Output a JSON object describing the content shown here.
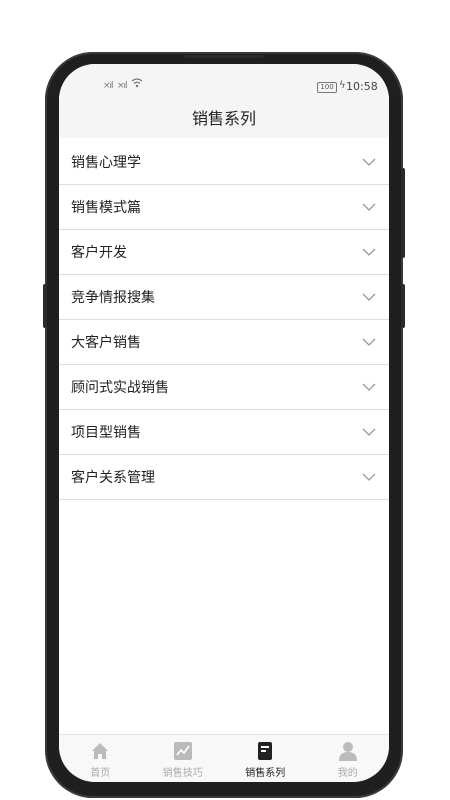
{
  "status": {
    "time": "10:58",
    "battery": "100"
  },
  "header": {
    "title": "销售系列"
  },
  "list": {
    "items": [
      {
        "label": "销售心理学"
      },
      {
        "label": "销售模式篇"
      },
      {
        "label": "客户开发"
      },
      {
        "label": "竞争情报搜集"
      },
      {
        "label": "大客户销售"
      },
      {
        "label": "顾问式实战销售"
      },
      {
        "label": "项目型销售"
      },
      {
        "label": "客户关系管理"
      }
    ]
  },
  "tabbar": {
    "tabs": [
      {
        "label": "首页",
        "icon": "home-icon"
      },
      {
        "label": "销售技巧",
        "icon": "chart-icon"
      },
      {
        "label": "销售系列",
        "icon": "book-icon",
        "active": true
      },
      {
        "label": "我的",
        "icon": "user-icon"
      }
    ]
  },
  "colors": {
    "active": "#222222",
    "inactive": "#aaaaaa",
    "divider": "#dcdcdc"
  }
}
